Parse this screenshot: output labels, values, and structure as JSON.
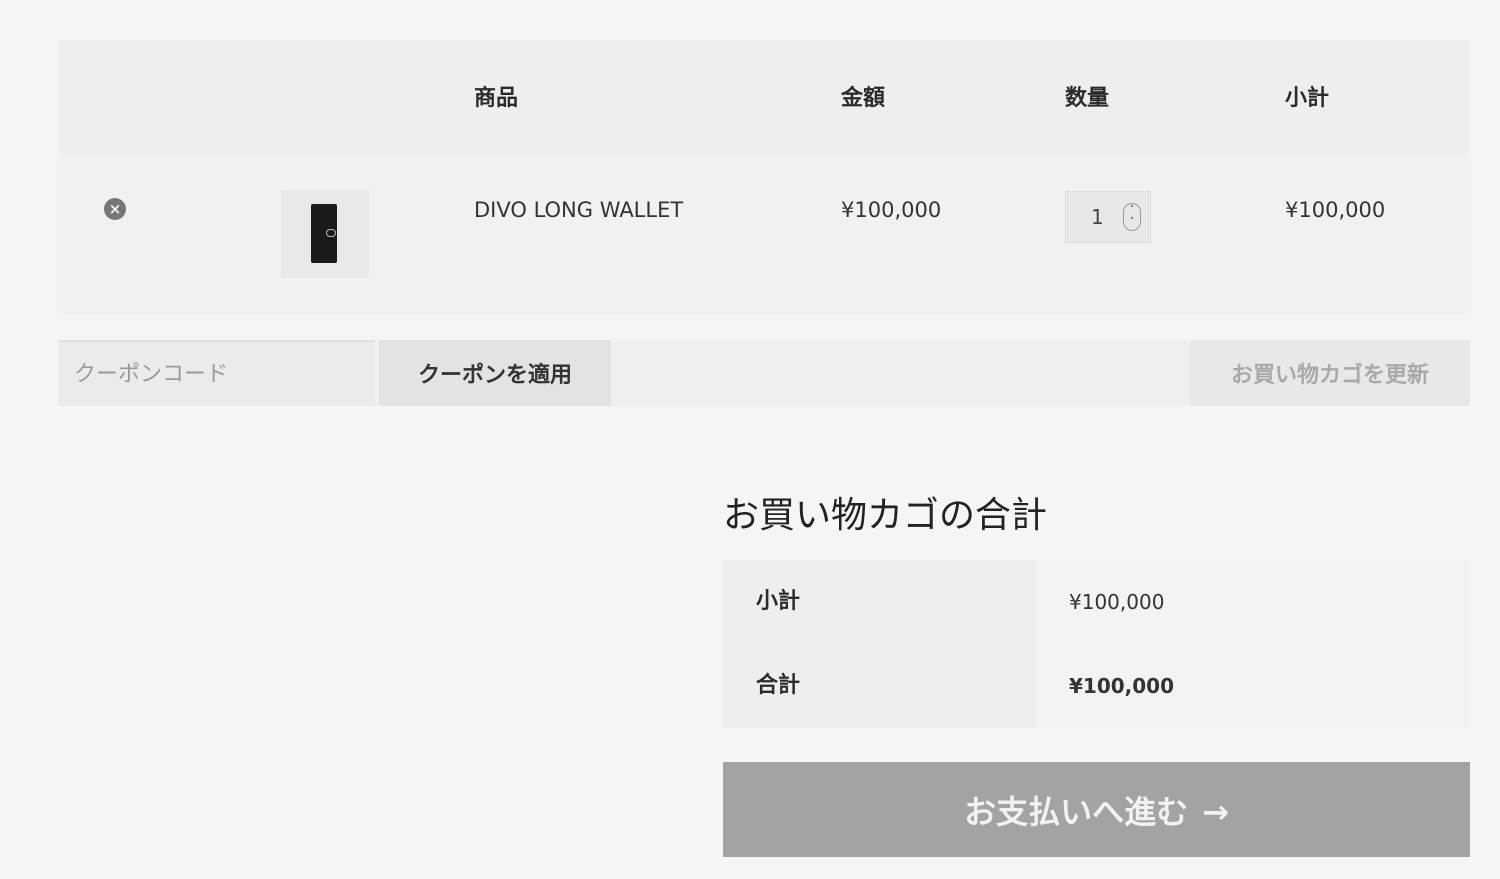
{
  "cart": {
    "headers": {
      "product": "商品",
      "price": "金額",
      "quantity": "数量",
      "subtotal": "小計"
    },
    "items": [
      {
        "name": "DIVO LONG WALLET",
        "price": "¥100,000",
        "quantity": "1",
        "subtotal": "¥100,000",
        "remove_icon": "×",
        "thumbnail_icon": "wallet-thumbnail"
      }
    ]
  },
  "coupon": {
    "placeholder": "クーポンコード",
    "apply_label": "クーポンを適用",
    "update_label": "お買い物カゴを更新"
  },
  "totals": {
    "title": "お買い物カゴの合計",
    "subtotal_label": "小計",
    "subtotal_value": "¥100,000",
    "total_label": "合計",
    "total_value": "¥100,000"
  },
  "checkout": {
    "label": "お支払いへ進む",
    "arrow": "→"
  },
  "colors": {
    "background": "#f5f5f5",
    "header_bg": "#eeeeee",
    "checkout_bg": "#a3a3a3"
  }
}
